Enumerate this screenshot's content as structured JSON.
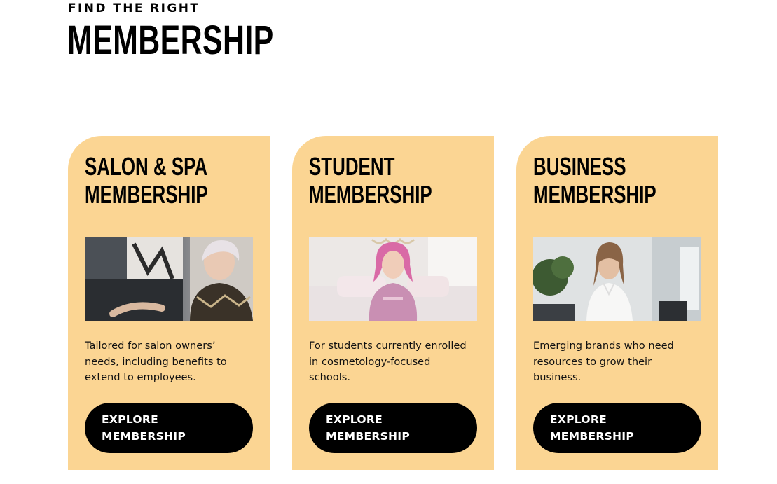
{
  "header": {
    "eyebrow": "FIND THE RIGHT",
    "title": "MEMBERSHIP"
  },
  "colors": {
    "card_background": "#fbd593",
    "button_background": "#000000",
    "button_text": "#ffffff"
  },
  "cards": [
    {
      "title_line1": "SALON & SPA",
      "title_line2": "MEMBERSHIP",
      "photo": "woman-with-short-platinum-hair-photo",
      "description": "Tailored for salon owners’ needs, including benefits to extend to employees.",
      "button_line1": "EXPLORE",
      "button_line2": "MEMBERSHIP"
    },
    {
      "title_line1": "STUDENT",
      "title_line2": "MEMBERSHIP",
      "photo": "woman-with-pink-hair-in-pink-hoodie-photo",
      "description": "For students currently enrolled in cosmetology-focused schools.",
      "button_line1": "EXPLORE",
      "button_line2": "MEMBERSHIP"
    },
    {
      "title_line1": "BUSINESS",
      "title_line2": "MEMBERSHIP",
      "photo": "businesswoman-in-office-photo",
      "description": "Emerging brands who need resources to grow their business.",
      "button_line1": "EXPLORE",
      "button_line2": "MEMBERSHIP"
    }
  ]
}
